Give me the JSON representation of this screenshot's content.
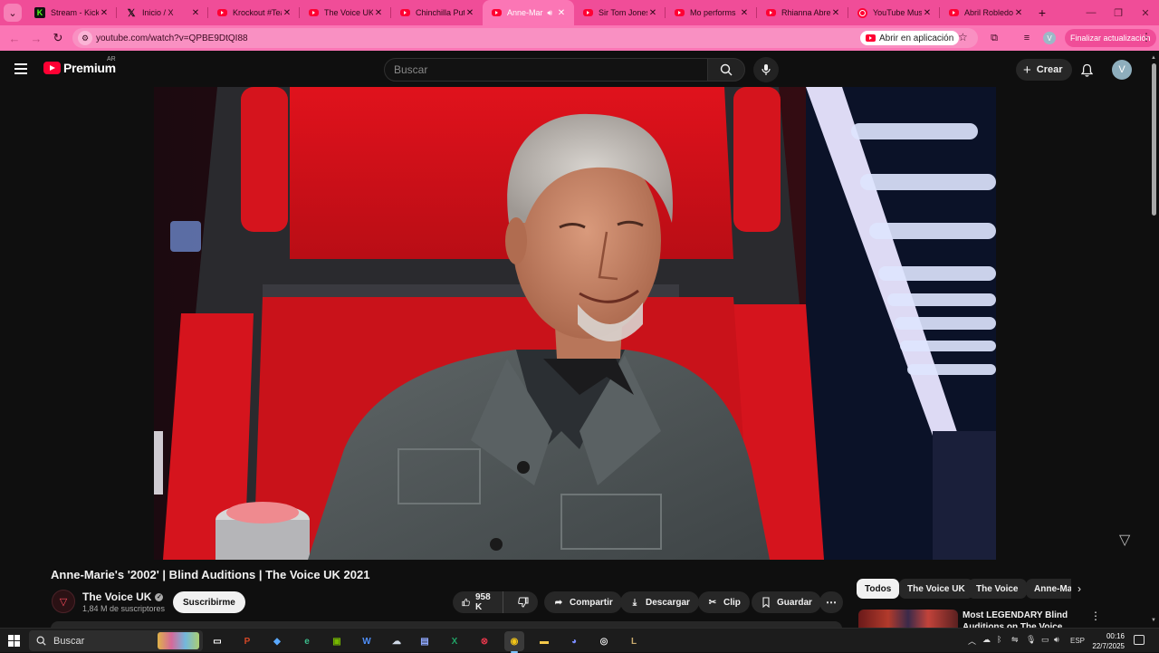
{
  "browser": {
    "tabs": [
      {
        "title": "Stream - Kick",
        "favicon": "kick-icon",
        "active": false
      },
      {
        "title": "Inicio / X",
        "favicon": "x-icon",
        "active": false
      },
      {
        "title": "Krockout #Tea",
        "favicon": "youtube-icon",
        "active": false
      },
      {
        "title": "The Voice UK -",
        "favicon": "youtube-icon",
        "active": false
      },
      {
        "title": "Chinchilla Put",
        "favicon": "youtube-icon",
        "active": false
      },
      {
        "title": "Anne-Mar",
        "favicon": "youtube-icon",
        "active": true,
        "audio": true
      },
      {
        "title": "Sir Tom Jones",
        "favicon": "youtube-icon",
        "active": false
      },
      {
        "title": "Mo performs",
        "favicon": "youtube-icon",
        "active": false
      },
      {
        "title": "Rhianna Abrey",
        "favicon": "youtube-icon",
        "active": false
      },
      {
        "title": "YouTube Music",
        "favicon": "youtube-music-icon",
        "active": false
      },
      {
        "title": "Abril Robledo",
        "favicon": "youtube-icon",
        "active": false
      }
    ],
    "url": "youtube.com/watch?v=QPBE9DtQI88",
    "open_in_app_label": "Abrir en aplicación",
    "profile_initial": "V",
    "update_label": "Finalizar actualización",
    "accent_color": "#f04d98"
  },
  "youtube": {
    "logo_text": "Premium",
    "region": "AR",
    "search_placeholder": "Buscar",
    "create_label": "Crear",
    "avatar_initial": "V"
  },
  "video": {
    "title": "Anne-Marie's '2002' | Blind Auditions | The Voice UK 2021",
    "channel_name": "The Voice UK",
    "subscribers": "1,84 M de suscriptores",
    "subscribe_label": "Suscribirme",
    "likes": "958 K",
    "share_label": "Compartir",
    "download_label": "Descargar",
    "clip_label": "Clip",
    "save_label": "Guardar"
  },
  "sidebar": {
    "chips": [
      "Todos",
      "The Voice UK",
      "The Voice",
      "Anne-Ma"
    ],
    "recommendation_title": "Most LEGENDARY Blind Auditions on The Voice"
  },
  "taskbar": {
    "search_label": "Buscar",
    "language": "ESP",
    "time": "00:16",
    "date": "22/7/2025"
  }
}
